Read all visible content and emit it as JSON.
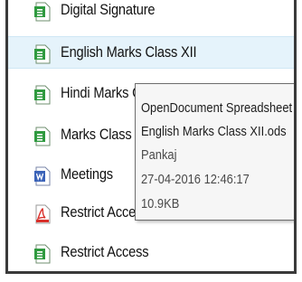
{
  "files": [
    {
      "name": "Digital Signature",
      "icon": "spreadsheet-icon"
    },
    {
      "name": "English Marks Class XII",
      "icon": "spreadsheet-icon"
    },
    {
      "name": "Hindi Marks Class XII",
      "icon": "spreadsheet-icon"
    },
    {
      "name": "Marks Class XII",
      "icon": "spreadsheet-icon"
    },
    {
      "name": "Meetings",
      "icon": "document-icon"
    },
    {
      "name": "Restrict Access",
      "icon": "pdf-icon"
    },
    {
      "name": "Restrict Access",
      "icon": "spreadsheet-icon"
    }
  ],
  "tooltip": {
    "type": "OpenDocument Spreadsheet",
    "filename": "English Marks Class XII.ods",
    "author": "Pankaj",
    "date": "27-04-2016 12:46:17",
    "size": "10.9KB"
  },
  "colors": {
    "hover_row": "#e5f3fb",
    "spreadsheet_green": "#2f9a3f",
    "document_blue": "#3b63b8",
    "pdf_red": "#d9302b"
  }
}
